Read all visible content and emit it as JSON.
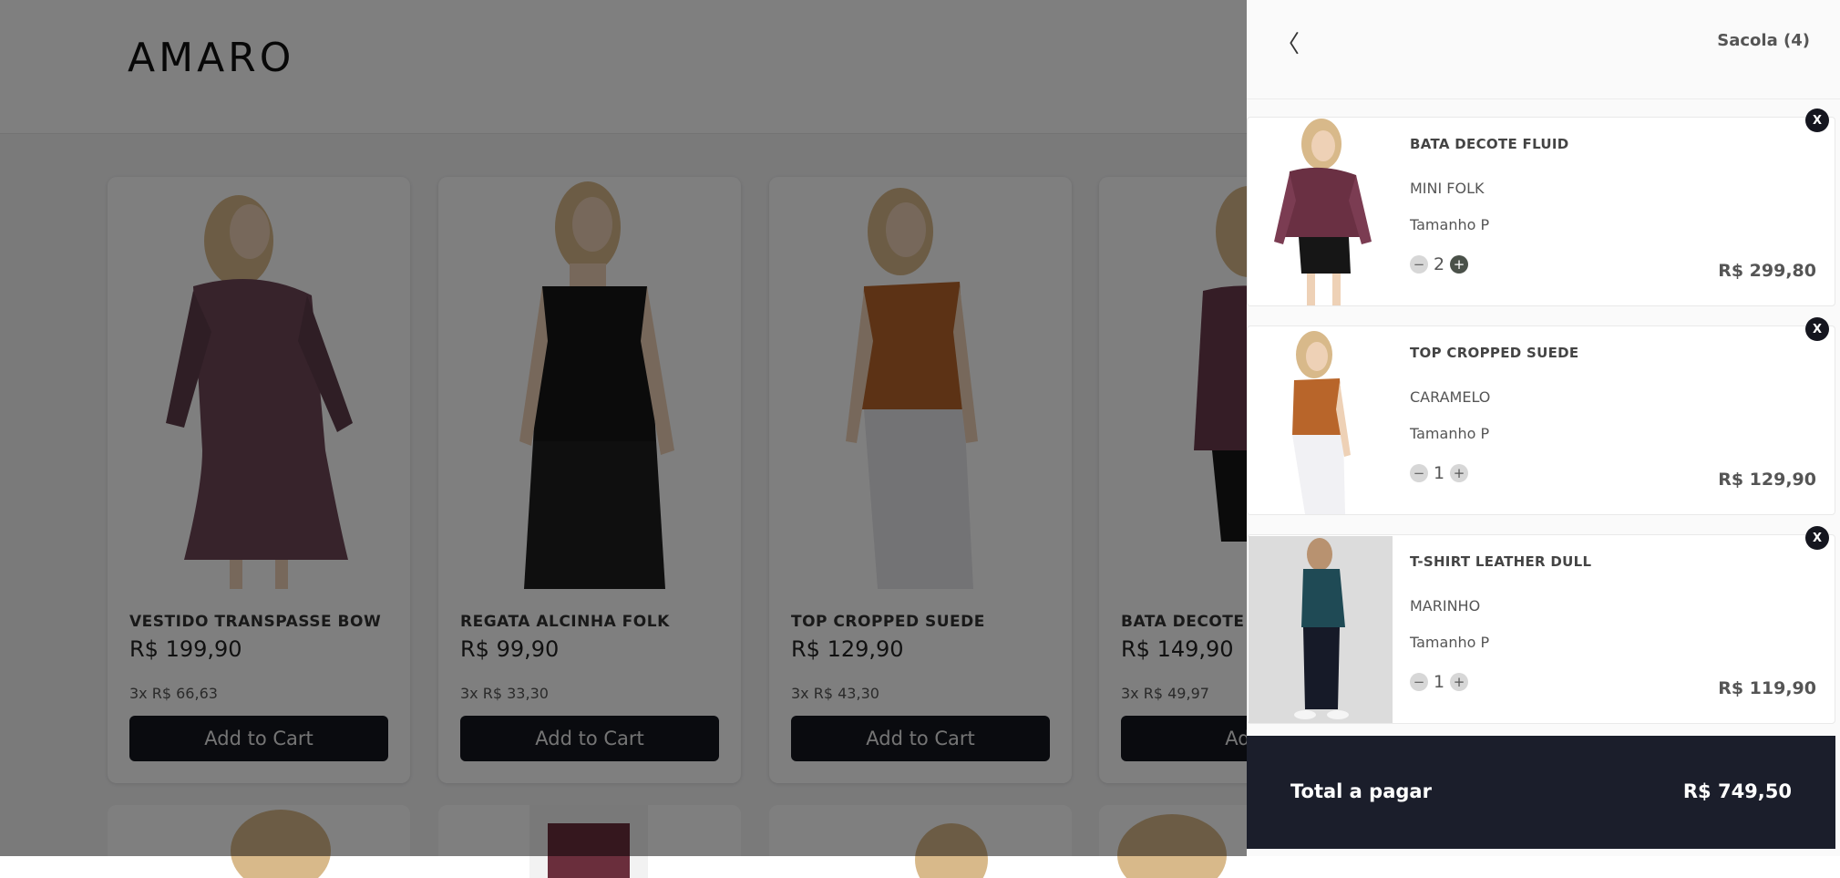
{
  "brand": {
    "logo": "AMARO"
  },
  "catalog": {
    "products": [
      {
        "name": "VESTIDO TRANSPASSE BOW",
        "price": "R$ 199,90",
        "installments": "3x R$ 66,63",
        "button": "Add to Cart"
      },
      {
        "name": "REGATA ALCINHA FOLK",
        "price": "R$ 99,90",
        "installments": "3x R$ 33,30",
        "button": "Add to Cart"
      },
      {
        "name": "TOP CROPPED SUEDE",
        "price": "R$ 129,90",
        "installments": "3x R$ 43,30",
        "button": "Add to Cart"
      },
      {
        "name": "BATA DECOTE F",
        "price": "R$ 149,90",
        "installments": "3x R$ 49,97",
        "button": "Add t"
      }
    ]
  },
  "cart": {
    "back_icon": "chevron-left-icon",
    "title": "Sacola (4)",
    "remove_label": "X",
    "minus_label": "−",
    "plus_label": "+",
    "items": [
      {
        "name": "BATA DECOTE FLUID",
        "color": "MINI FOLK",
        "size": "Tamanho P",
        "quantity": "2",
        "price": "R$ 299,80"
      },
      {
        "name": "TOP CROPPED SUEDE",
        "color": "CARAMELO",
        "size": "Tamanho P",
        "quantity": "1",
        "price": "R$ 129,90"
      },
      {
        "name": "T-SHIRT LEATHER DULL",
        "color": "MARINHO",
        "size": "Tamanho P",
        "quantity": "1",
        "price": "R$ 119,90"
      }
    ],
    "total_label": "Total a pagar",
    "total_value": "R$ 749,50"
  },
  "colors": {
    "button_dark": "#15161f",
    "total_bar": "#1b1e2b",
    "overlay": "rgba(0,0,0,0.5)"
  }
}
